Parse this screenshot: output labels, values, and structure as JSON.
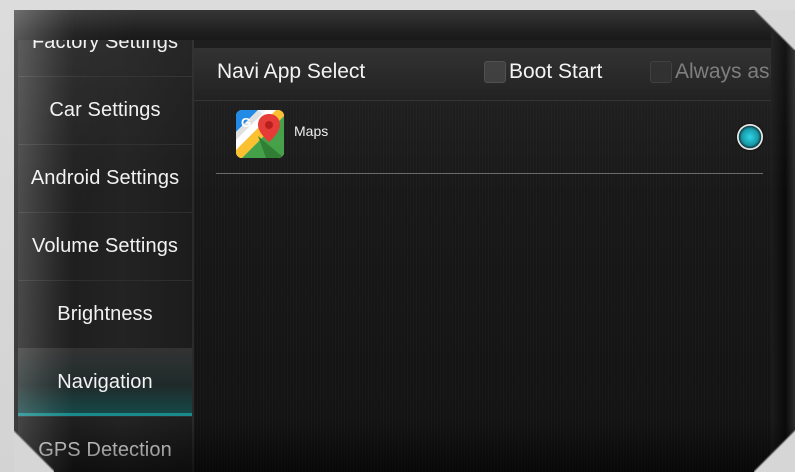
{
  "menu": {
    "items": [
      {
        "label": "Factory Settings",
        "active": false
      },
      {
        "label": "Car Settings",
        "active": false
      },
      {
        "label": "Android Settings",
        "active": false
      },
      {
        "label": "Volume Settings",
        "active": false
      },
      {
        "label": "Brightness",
        "active": false
      },
      {
        "label": "Navigation",
        "active": true
      },
      {
        "label": "GPS Detection",
        "active": false
      }
    ]
  },
  "panel": {
    "title": "Navi App Select",
    "boot_start": {
      "label": "Boot Start",
      "checked": false
    },
    "always_ask": {
      "label": "Always ask",
      "checked": false,
      "enabled": false
    }
  },
  "apps": [
    {
      "label": "Maps",
      "icon": "google-maps-icon",
      "selected": true
    }
  ],
  "colors": {
    "accent": "#1a8a8a",
    "radio": "#2ad4e6"
  }
}
